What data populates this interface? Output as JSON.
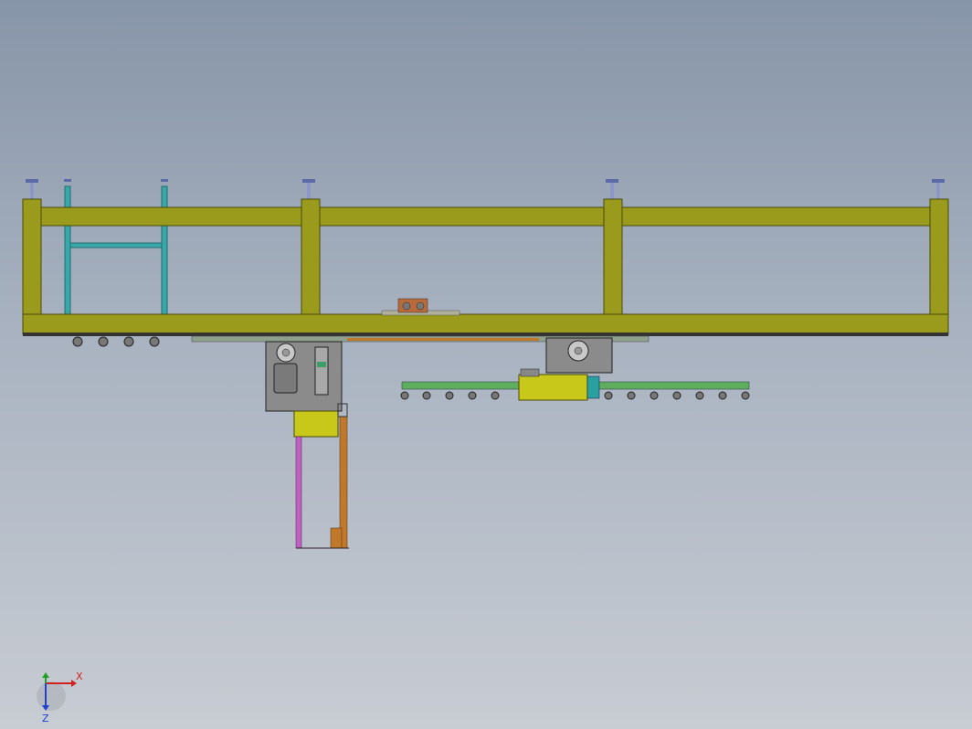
{
  "viewport": {
    "background_top": "#8795a8",
    "background_bottom": "#c8ccd3"
  },
  "colors": {
    "frame": "#9a9a1c",
    "frame_dark": "#6e6e10",
    "cyan_post": "#3aa7a8",
    "leveling_foot": "#5c6aa8",
    "gray_box": "#8b8b8b",
    "yellow_block": "#c8c81a",
    "green_rail": "#5fae5f",
    "orange_bar": "#c0782a",
    "magenta_bar": "#c060c0",
    "teal_block": "#2aa0a0",
    "axis_x": "#d02020",
    "axis_y": "#20a020",
    "axis_z": "#2040d0"
  },
  "triad": {
    "x_label": "X",
    "y_label": "Y",
    "z_label": "Z"
  }
}
